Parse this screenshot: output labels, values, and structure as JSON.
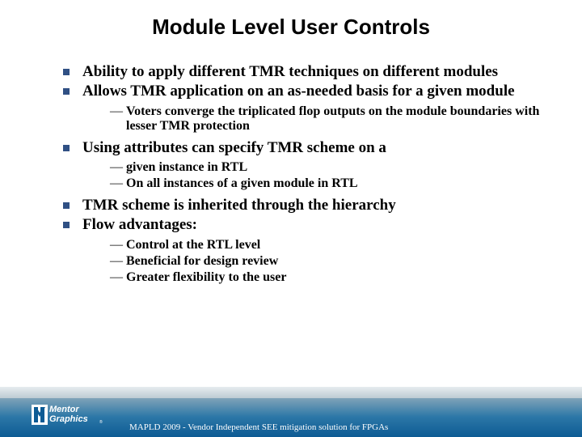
{
  "title": "Module Level User Controls",
  "bullets": {
    "b0": "Ability to apply different TMR techniques on different modules",
    "b1": "Allows TMR application on an as-needed basis for a given module",
    "b1_sub": {
      "s0": "Voters converge the triplicated flop outputs on the module boundaries with lesser TMR protection"
    },
    "b2": "Using attributes can specify TMR scheme on a",
    "b2_sub": {
      "s0": "given instance in RTL",
      "s1": "On all instances of a given module in RTL"
    },
    "b3": "TMR scheme is inherited through the hierarchy",
    "b4": "Flow advantages:",
    "b4_sub": {
      "s0": "Control at the RTL level",
      "s1": "Beneficial for design review",
      "s2": "Greater flexibility to the user"
    }
  },
  "footer": "MAPLD 2009 - Vendor Independent SEE mitigation solution for FPGAs",
  "logo": {
    "top": "Mentor",
    "bottom": "Graphics",
    "reg": "®"
  }
}
